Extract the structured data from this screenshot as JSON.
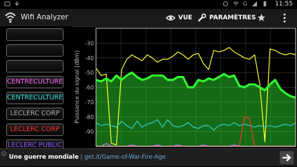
{
  "status_bar": {
    "time": "11:55",
    "signal_letter": "G"
  },
  "action_bar": {
    "title": "Wifi Analyzer",
    "view_label": "VUE",
    "settings_label": "PARAMÈTRES"
  },
  "ssid_list": [
    {
      "label": "",
      "color": "#ffffff"
    },
    {
      "label": "",
      "color": "#ffffff"
    },
    {
      "label": "",
      "color": "#ffffff"
    },
    {
      "label": "CENTRECULTUREL",
      "color": "#ff66ff"
    },
    {
      "label": "CENTRECULTUREL",
      "color": "#33e0e0"
    },
    {
      "label": "LECLERC CORP",
      "color": "#a8a8a8"
    },
    {
      "label": "LECLERC CORP",
      "color": "#ff3333"
    },
    {
      "label": "LECLERC PUBLIC",
      "color": "#8855ff"
    }
  ],
  "chart_data": {
    "type": "line",
    "ylabel": "Puissance du signal [dBm]",
    "ylim": [
      -100,
      -20
    ],
    "yticks": [
      "-30",
      "-40",
      "-50",
      "-60",
      "-70",
      "-80",
      "-90"
    ],
    "grid": true,
    "x": [
      0,
      1,
      2,
      3,
      4,
      5,
      6,
      7,
      8,
      9,
      10,
      11,
      12,
      13,
      14,
      15,
      16,
      17,
      18,
      19,
      20,
      21,
      22,
      23,
      24,
      25,
      26,
      27,
      28,
      29,
      30,
      31,
      32,
      33,
      34,
      35,
      36,
      37,
      38,
      39
    ],
    "series": [
      {
        "color": "#ffff33",
        "fill": false,
        "values": [
          -47,
          -52,
          -51,
          -98,
          -99,
          -48,
          -41,
          -38,
          -40,
          -42,
          -38,
          -40,
          -43,
          -41,
          -41,
          -39,
          -36,
          -38,
          -41,
          -38,
          -37,
          -44,
          -48,
          -35,
          -36,
          -35,
          -33,
          -36,
          -38,
          -40,
          -41,
          -38,
          -58,
          -97,
          -34,
          -35,
          -37,
          -38,
          -37,
          -38
        ]
      },
      {
        "color": "#33ff33",
        "fill": true,
        "values": [
          -55,
          -56,
          -54,
          -56,
          -52,
          -55,
          -52,
          -50,
          -53,
          -55,
          -54,
          -52,
          -52,
          -52,
          -55,
          -55,
          -53,
          -53,
          -60,
          -60,
          -55,
          -56,
          -54,
          -55,
          -53,
          -51,
          -53,
          -52,
          -59,
          -60,
          -58,
          -58,
          -60,
          -62,
          -58,
          -55,
          -61,
          -64,
          -66,
          -67
        ]
      },
      {
        "color": "#33cccc",
        "fill": false,
        "values": [
          -84,
          -86,
          -85,
          -86,
          -87,
          -83,
          -86,
          -88,
          -83,
          -87,
          -85,
          -84,
          -82,
          -87,
          -82,
          -86,
          -87,
          -86,
          -84,
          -87,
          -88,
          -86,
          -86,
          -89,
          -86,
          -85,
          -86,
          -84,
          -86,
          -85,
          -86,
          -87,
          -86,
          -87,
          -86,
          -87,
          -86,
          -85,
          -86,
          -84
        ]
      },
      {
        "color": "#ff8800",
        "fill": false,
        "values": [
          -100,
          -100,
          -100,
          -100,
          -100,
          -100,
          -100,
          -100,
          -100,
          -100,
          -100,
          -100,
          -100,
          -100,
          -100,
          -100,
          -100,
          -100,
          -100,
          -100,
          -100,
          -100,
          -100,
          -100,
          -100,
          -100,
          -100,
          -100,
          -100,
          -100,
          -100,
          -100,
          -100,
          -100,
          -100,
          -100,
          -100,
          -100,
          -100,
          -100
        ]
      },
      {
        "color": "#cc66ff",
        "fill": false,
        "values": [
          -100,
          -100,
          -98,
          -100,
          -100,
          -100,
          -100,
          -99,
          -100,
          -100,
          -100,
          -100,
          -99,
          -100,
          -100,
          -100,
          -99,
          -100,
          -100,
          -100,
          -100,
          -99,
          -100,
          -100,
          -100,
          -100,
          -100,
          -99,
          -100,
          -100,
          -100,
          -100,
          -100,
          -100,
          -100,
          -100,
          -100,
          -100,
          -100,
          -100
        ]
      },
      {
        "color": "#ff3333",
        "fill": false,
        "values": [
          -100,
          -100,
          -100,
          -100,
          -100,
          -100,
          -100,
          -100,
          -100,
          -100,
          -100,
          -100,
          -100,
          -100,
          -100,
          -100,
          -100,
          -100,
          -100,
          -100,
          -100,
          -100,
          -100,
          -100,
          -100,
          -100,
          -100,
          -100,
          -100,
          -80,
          -81,
          -100,
          -100,
          -100,
          -100,
          -100,
          -100,
          -100,
          -100,
          -100
        ]
      }
    ]
  },
  "ad": {
    "title": "Une guerre mondiale",
    "separator": " | ",
    "link": "get.it/Game-of-War-Fire-Age"
  },
  "colors": {
    "accent_green": "#33ff33",
    "accent_yellow": "#ffff33",
    "background": "#000000"
  }
}
